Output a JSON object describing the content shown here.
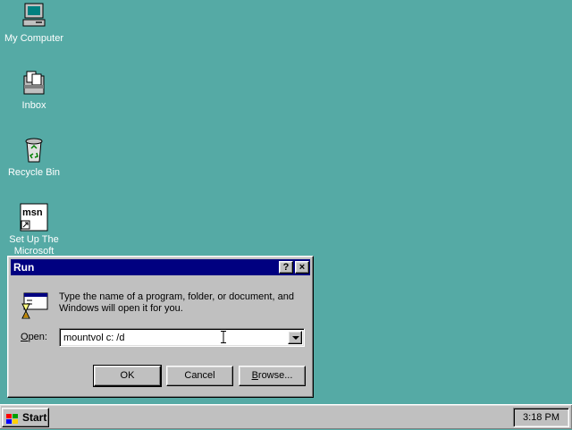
{
  "desktop": {
    "background_color": "#55aaa5",
    "icons": [
      {
        "label": "My Computer",
        "icon": "computer-icon"
      },
      {
        "label": "Inbox",
        "icon": "inbox-icon"
      },
      {
        "label": "Recycle Bin",
        "icon": "recycle-bin-icon"
      },
      {
        "label": "Set Up The Microsoft",
        "icon": "msn-icon"
      }
    ]
  },
  "run_dialog": {
    "title": "Run",
    "help_button": "?",
    "close_button": "×",
    "prompt": "Type the name of a program, folder, or document, and Windows will open it for you.",
    "open_label_prefix": "O",
    "open_label_rest": "pen:",
    "open_value": "mountvol c: /d",
    "ok_label": "OK",
    "cancel_label": "Cancel",
    "browse_prefix": "B",
    "browse_rest": "rowse..."
  },
  "taskbar": {
    "start_label": "Start",
    "clock": "3:18 PM"
  },
  "colors": {
    "titlebar": "#000080",
    "face": "#c0c0c0"
  }
}
